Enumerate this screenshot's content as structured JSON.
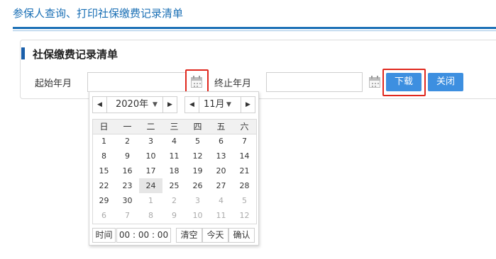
{
  "page": {
    "title": "参保人查询、打印社保缴费记录清单"
  },
  "section": {
    "title": "社保缴费记录清单"
  },
  "form": {
    "start_label": "起始年月",
    "start_value": "",
    "end_label": "终止年月",
    "end_value": "",
    "download_label": "下载",
    "close_label": "关闭"
  },
  "datepicker": {
    "year_label": "2020年",
    "month_label": "11月",
    "weekdays": [
      "日",
      "一",
      "二",
      "三",
      "四",
      "五",
      "六"
    ],
    "weeks": [
      [
        "1",
        "2",
        "3",
        "4",
        "5",
        "6",
        "7"
      ],
      [
        "8",
        "9",
        "10",
        "11",
        "12",
        "13",
        "14"
      ],
      [
        "15",
        "16",
        "17",
        "18",
        "19",
        "20",
        "21"
      ],
      [
        "22",
        "23",
        "24",
        "25",
        "26",
        "27",
        "28"
      ],
      [
        "29",
        "30",
        "1",
        "2",
        "3",
        "4",
        "5"
      ],
      [
        "6",
        "7",
        "8",
        "9",
        "10",
        "11",
        "12"
      ]
    ],
    "today": "24",
    "time_label": "时间",
    "time_value": "00 : 00 : 00",
    "clear_label": "清空",
    "today_label": "今天",
    "confirm_label": "确认"
  },
  "colors": {
    "accent": "#1a6fb5",
    "button": "#3d8fe0",
    "highlight": "#e0281e"
  },
  "icons": {
    "calendar": "calendar-icon",
    "prev": "triangle-left",
    "next": "triangle-right",
    "dropdown": "triangle-down"
  }
}
